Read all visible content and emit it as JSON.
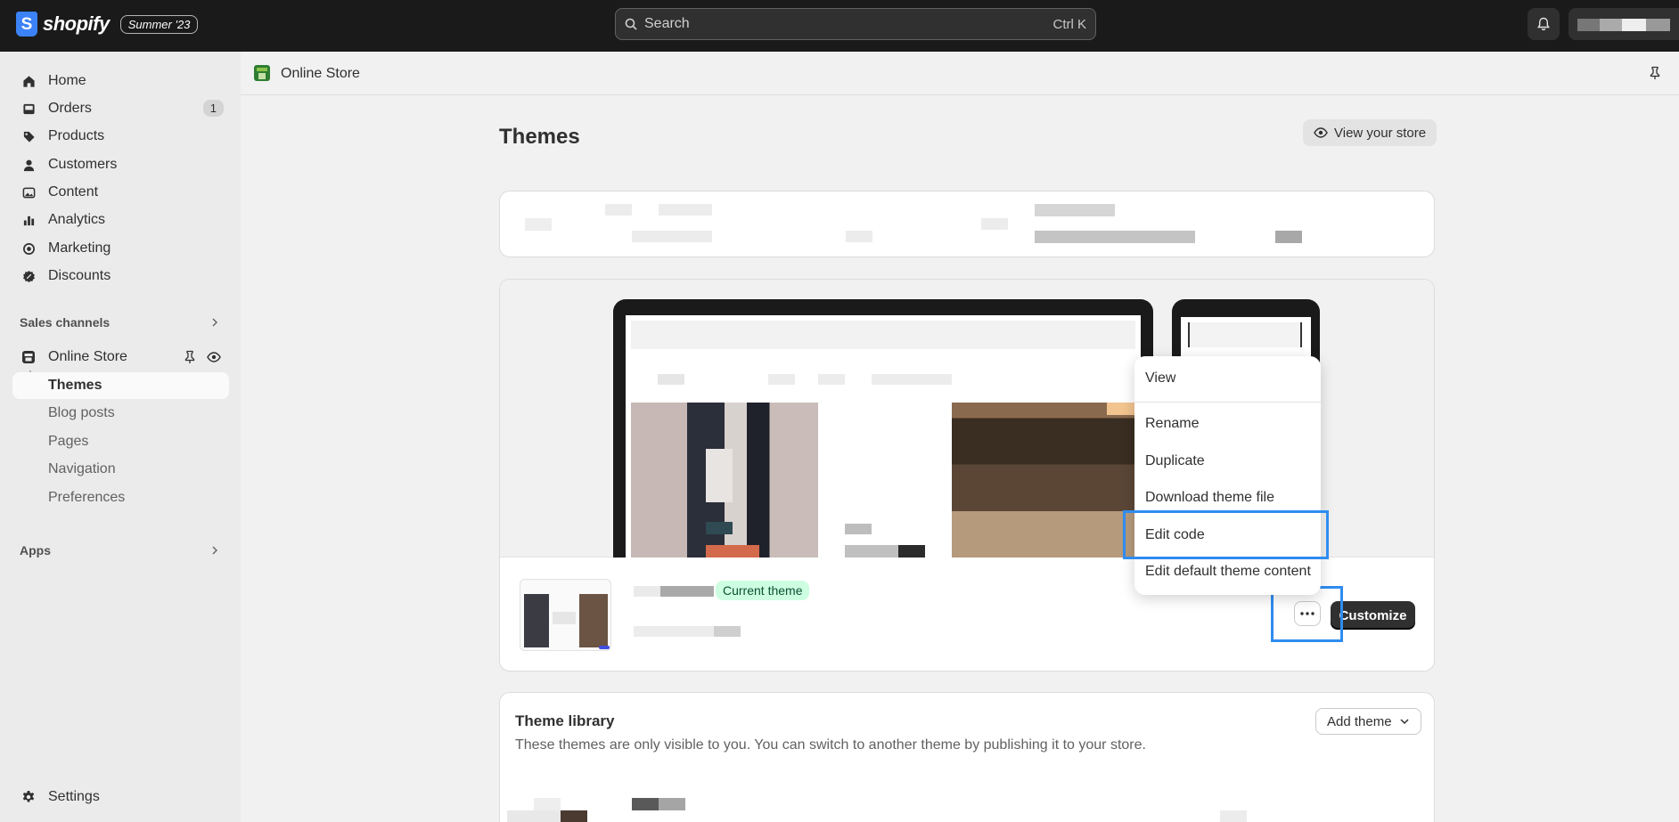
{
  "topbar": {
    "logo_text": "shopify",
    "logo_letter": "S",
    "edition": "Summer '23",
    "search_placeholder": "Search",
    "search_shortcut": "Ctrl K"
  },
  "sidebar": {
    "items": [
      {
        "label": "Home",
        "icon": "home-icon"
      },
      {
        "label": "Orders",
        "icon": "inbox-icon",
        "badge": "1"
      },
      {
        "label": "Products",
        "icon": "tag-icon"
      },
      {
        "label": "Customers",
        "icon": "person-icon"
      },
      {
        "label": "Content",
        "icon": "image-icon"
      },
      {
        "label": "Analytics",
        "icon": "bar-chart-icon"
      },
      {
        "label": "Marketing",
        "icon": "target-icon"
      },
      {
        "label": "Discounts",
        "icon": "discount-icon"
      }
    ],
    "sales_channels_title": "Sales channels",
    "online_store_label": "Online Store",
    "sub_items": [
      "Themes",
      "Blog posts",
      "Pages",
      "Navigation",
      "Preferences"
    ],
    "apps_title": "Apps",
    "settings_label": "Settings"
  },
  "breadcrumb": {
    "label": "Online Store"
  },
  "main": {
    "title": "Themes",
    "view_store_label": "View your store",
    "current_theme_badge": "Current theme",
    "customize_label": "Customize"
  },
  "menu": {
    "items": [
      "View",
      "Rename",
      "Duplicate",
      "Download theme file",
      "Edit code",
      "Edit default theme content"
    ]
  },
  "library": {
    "title": "Theme library",
    "description": "These themes are only visible to you. You can switch to another theme by publishing it to your store.",
    "add_theme_label": "Add theme"
  },
  "colors": {
    "highlight": "#2f8cf0",
    "current_badge_bg": "#cdfee1",
    "topbar_bg": "#1a1a1a"
  }
}
